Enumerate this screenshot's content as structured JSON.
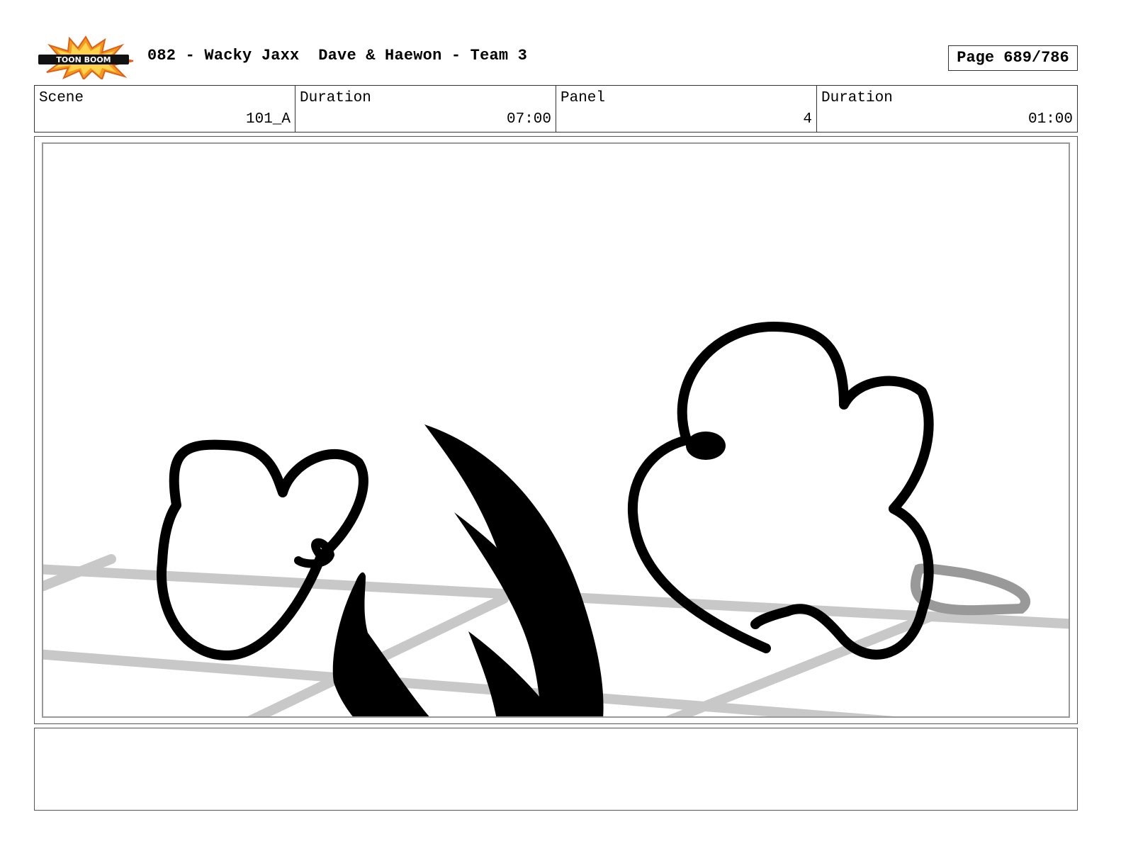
{
  "header": {
    "logo_text": "TOON BOOM",
    "title": "082 - Wacky Jaxx  Dave & Haewon - Team 3",
    "page_label": "Page 689/786"
  },
  "info": {
    "scene_label": "Scene",
    "scene_value": "101_A",
    "scene_duration_label": "Duration",
    "scene_duration_value": "07:00",
    "panel_label": "Panel",
    "panel_value": "4",
    "panel_duration_label": "Duration",
    "panel_duration_value": "01:00"
  },
  "panel_image": {
    "description_icon": "storyboard-drawing",
    "ink_color": "#000000",
    "layout_line_color": "#c8c8c8"
  },
  "notes": {
    "text": ""
  }
}
